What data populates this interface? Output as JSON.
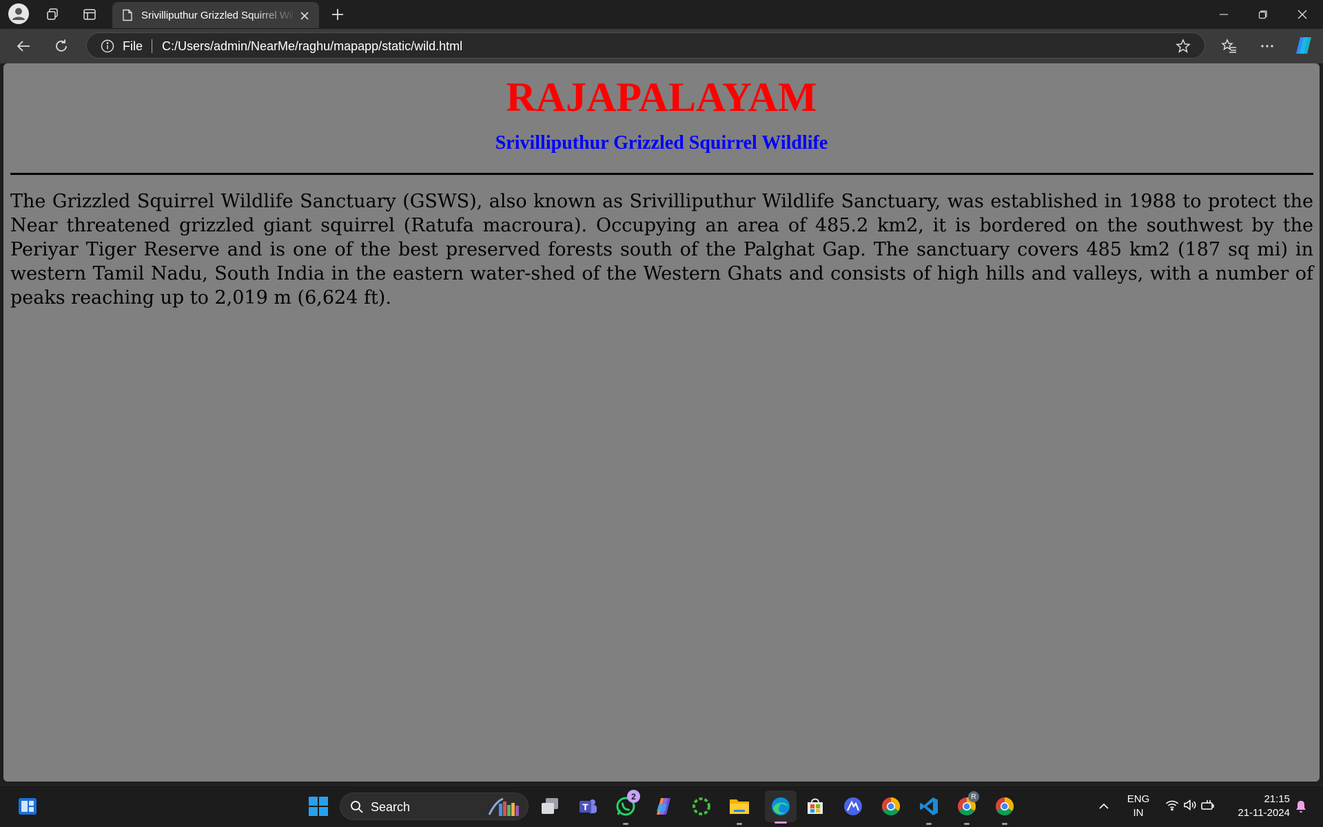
{
  "browser": {
    "tab_title": "Srivilliputhur Grizzled Squirrel Wildlife",
    "address": {
      "scheme_label": "File",
      "url": "C:/Users/admin/NearMe/raghu/mapapp/static/wild.html"
    },
    "icons": [
      "profile-icon",
      "workspaces-icon",
      "vertical-tabs-icon",
      "page-icon",
      "close-tab-icon",
      "new-tab-icon",
      "minimize-icon",
      "restore-icon",
      "close-window-icon",
      "back-icon",
      "refresh-icon",
      "info-icon",
      "favorite-star-icon",
      "favorites-icon",
      "more-icon",
      "copilot-icon"
    ]
  },
  "page": {
    "title": "RAJAPALAYAM",
    "subtitle": "Srivilliputhur Grizzled Squirrel Wildlife",
    "paragraph": "The Grizzled Squirrel Wildlife Sanctuary (GSWS), also known as Srivilliputhur Wildlife Sanctuary, was established in 1988 to protect the Near threatened grizzled giant squirrel (Ratufa macroura). Occupying an area of 485.2 km2, it is bordered on the southwest by the Periyar Tiger Reserve and is one of the best preserved forests south of the Palghat Gap. The sanctuary covers 485 km2 (187 sq mi) in western Tamil Nadu, South India in the eastern water-shed of the Western Ghats and consists of high hills and valleys, with a number of peaks reaching up to 2,019 m (6,624 ft).",
    "colors": {
      "background": "#808080",
      "title": "#ff0000",
      "subtitle": "#0000ff",
      "text": "#000000"
    }
  },
  "taskbar": {
    "search_label": "Search",
    "whatsapp_badge": "2",
    "chrome_profile_badge": "R",
    "language_line1": "ENG",
    "language_line2": "IN",
    "time": "21:15",
    "date": "21-11-2024",
    "apps": [
      "widgets-icon",
      "start-icon",
      "search-icon",
      "task-view-icon",
      "teams-icon",
      "whatsapp-icon",
      "copilot-app-icon",
      "app-ring-icon",
      "file-explorer-icon",
      "edge-icon",
      "store-icon",
      "app-blue-icon",
      "chrome-icon",
      "vscode-icon",
      "chrome-profile-icon",
      "chrome-icon-2"
    ]
  }
}
